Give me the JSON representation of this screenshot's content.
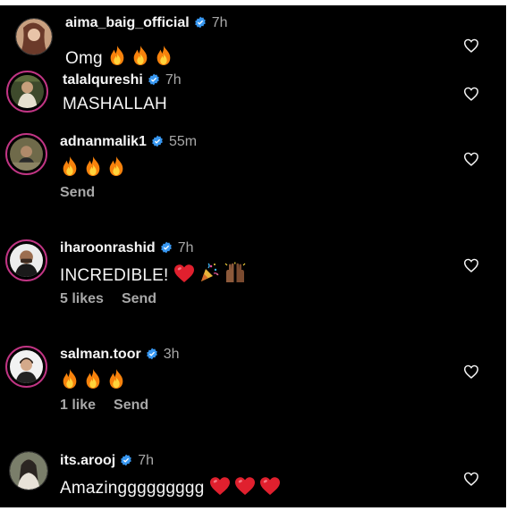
{
  "comments": [
    {
      "username": "aima_baig_official",
      "time": "7h",
      "text": "Omg",
      "emojis": [
        "fire",
        "fire",
        "fire"
      ]
    },
    {
      "username": "talalqureshi",
      "time": "7h",
      "text": "MASHALLAH"
    },
    {
      "username": "adnanmalik1",
      "time": "55m",
      "emojis": [
        "fire",
        "fire",
        "fire"
      ],
      "send": "Send"
    },
    {
      "username": "iharoonrashid",
      "time": "7h",
      "text": "INCREDIBLE!",
      "emojis": [
        "heart",
        "party-popper",
        "raised-hands"
      ],
      "likes": "5 likes",
      "send": "Send"
    },
    {
      "username": "salman.toor",
      "time": "3h",
      "emojis": [
        "fire",
        "fire",
        "fire"
      ],
      "likes": "1 like",
      "send": "Send"
    },
    {
      "username": "its.arooj",
      "time": "7h",
      "text": "Amazinggggggggg",
      "emojis": [
        "heart",
        "heart",
        "heart"
      ]
    }
  ],
  "colors": {
    "background": "#000000",
    "text": "#f5f5f5",
    "muted": "#a8a8a8",
    "verified": "#3897f0",
    "story_ring": "#c13584"
  }
}
